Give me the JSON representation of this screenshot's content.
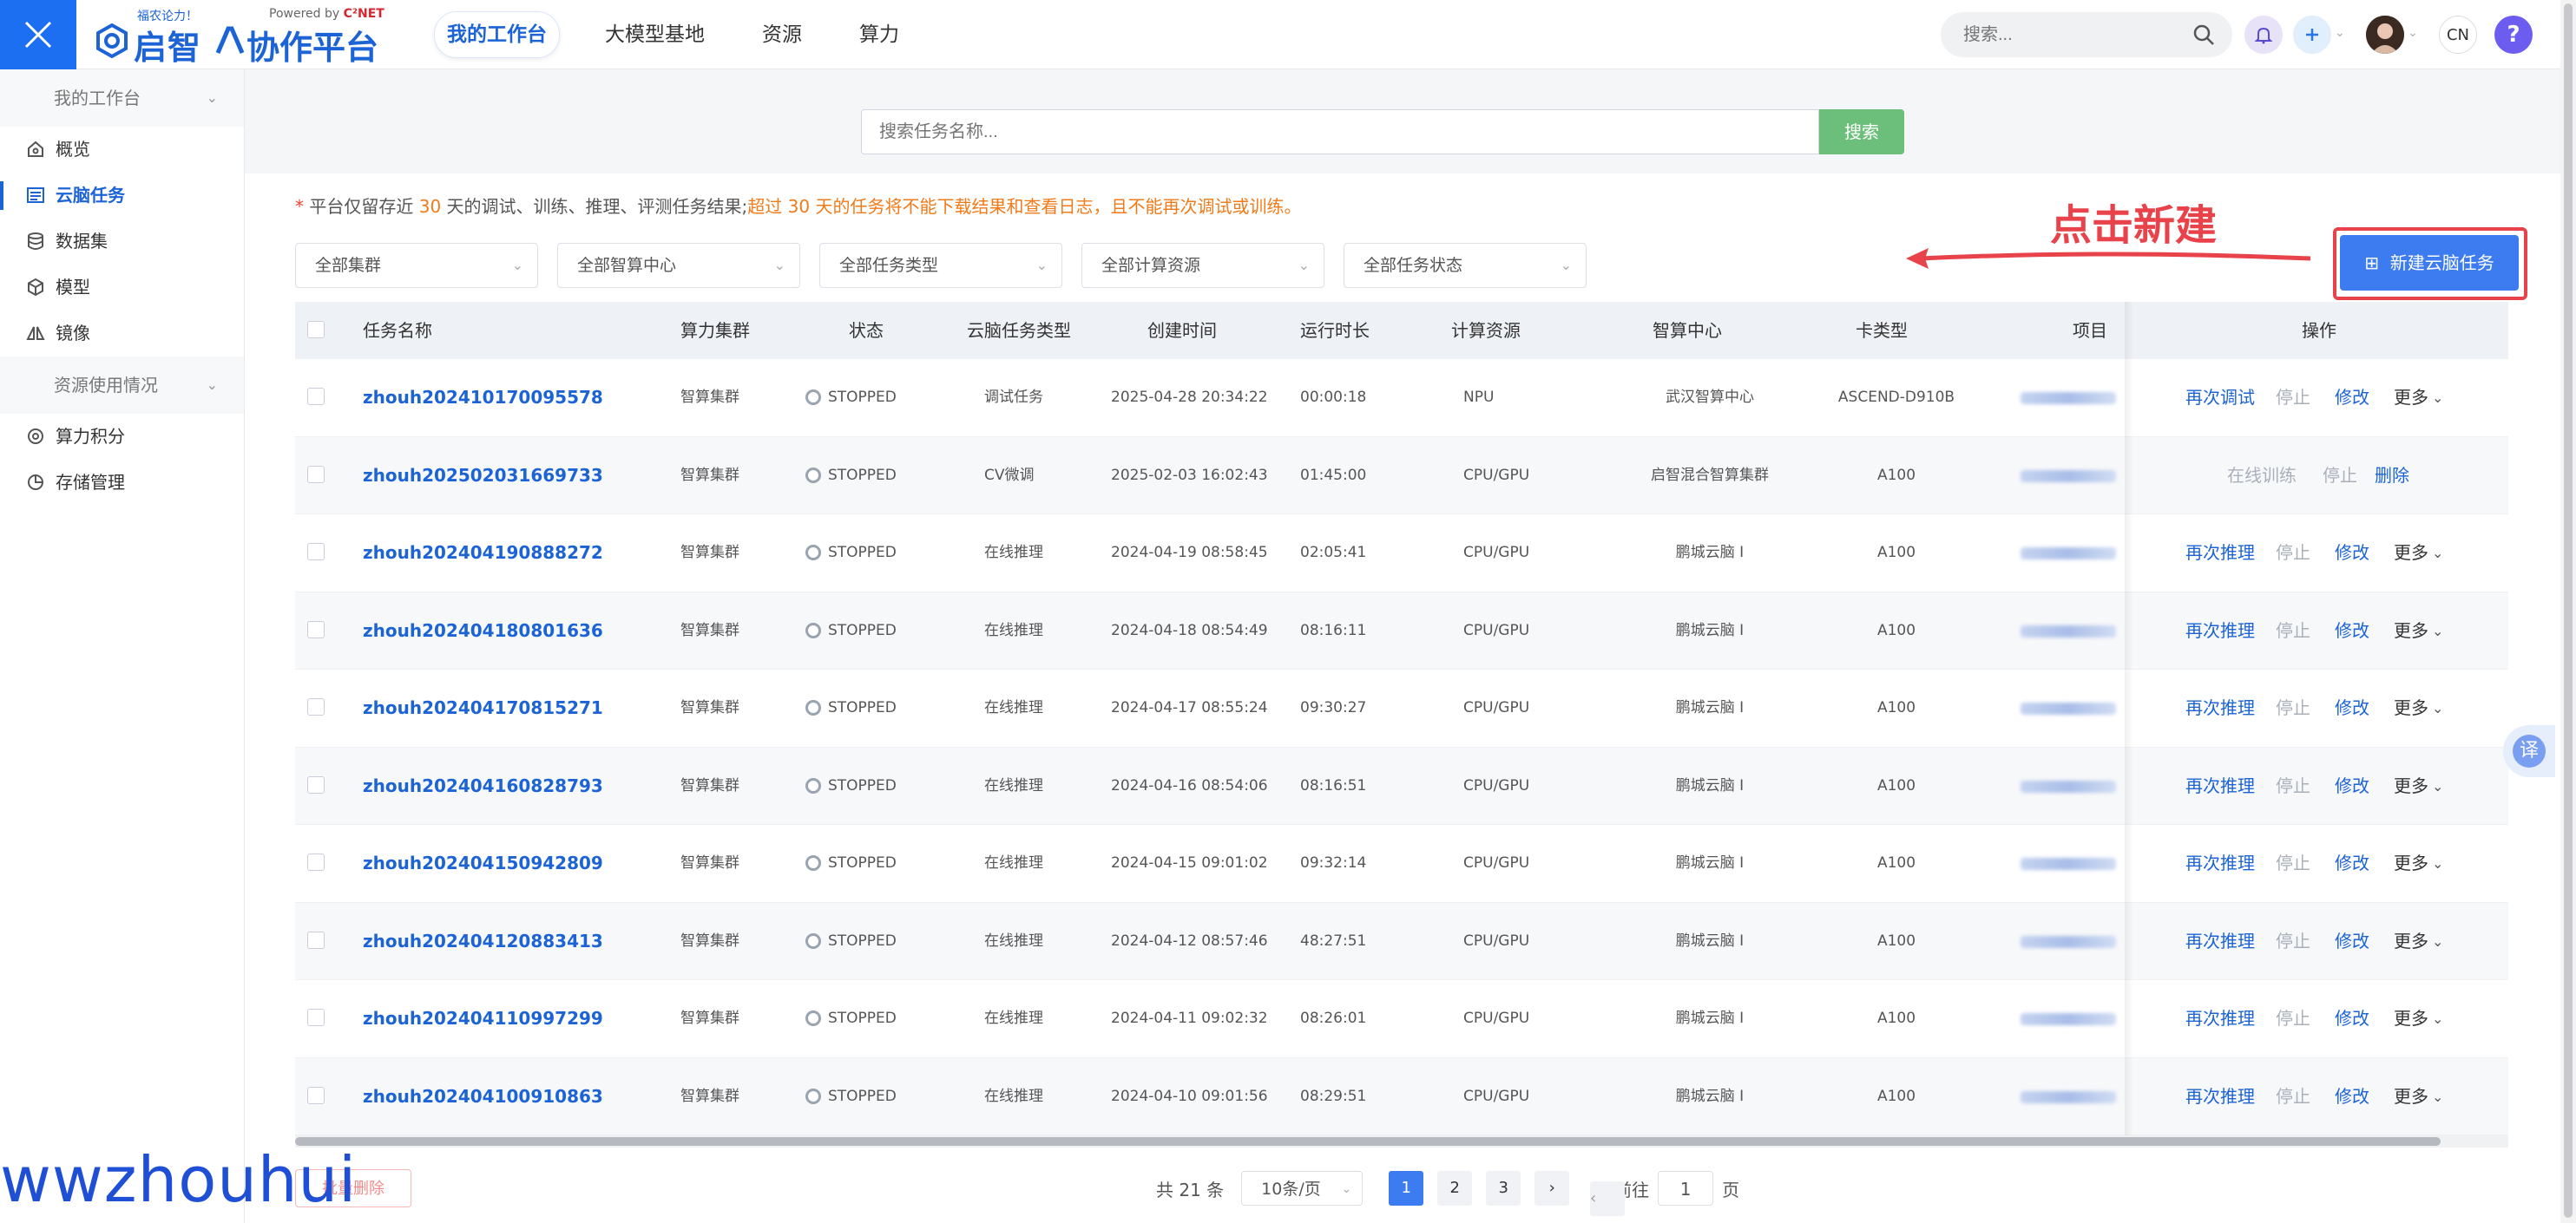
{
  "topbar": {
    "logo_slogan": "福农论力！",
    "powered_prefix": "Powered by ",
    "powered_brand": "C²NET",
    "logo_name1": "启智",
    "logo_name2": "协作平台",
    "tabs": [
      {
        "label": "我的工作台",
        "active": true
      },
      {
        "label": "大模型基地",
        "active": false
      },
      {
        "label": "资源",
        "active": false
      },
      {
        "label": "算力",
        "active": false
      }
    ],
    "search_placeholder": "搜索...",
    "lang": "CN",
    "help": "?"
  },
  "sidebar": {
    "group1": "我的工作台",
    "items": [
      {
        "label": "概览",
        "icon": "home-icon"
      },
      {
        "label": "云脑任务",
        "icon": "task-list-icon",
        "active": true
      },
      {
        "label": "数据集",
        "icon": "database-icon"
      },
      {
        "label": "模型",
        "icon": "model-cube-icon"
      },
      {
        "label": "镜像",
        "icon": "image-mirror-icon"
      }
    ],
    "group2": "资源使用情况",
    "items2": [
      {
        "label": "算力积分",
        "icon": "points-icon"
      },
      {
        "label": "存储管理",
        "icon": "storage-pie-icon"
      }
    ]
  },
  "search": {
    "placeholder": "搜索任务名称...",
    "button": "搜索"
  },
  "notice": {
    "prefix": "平台仅留存近",
    "days1": "30",
    "middle": "天的调试、训练、推理、评测任务结果;",
    "warn_prefix": "超过",
    "days2": "30",
    "warn_suffix": "天的任务将不能下载结果和查看日志，且不能再次调试或训练。"
  },
  "filters": [
    "全部集群",
    "全部智算中心",
    "全部任务类型",
    "全部计算资源",
    "全部任务状态"
  ],
  "annotation": "点击新建",
  "new_button": "新建云脑任务",
  "table": {
    "headers": [
      "任务名称",
      "算力集群",
      "状态",
      "云脑任务类型",
      "创建时间",
      "运行时长",
      "计算资源",
      "智算中心",
      "卡类型",
      "项目",
      "操作"
    ],
    "rows": [
      {
        "name": "zhouh202410170095578",
        "cluster": "智算集群",
        "status": "STOPPED",
        "type": "调试任务",
        "created": "2025-04-28 20:34:22",
        "duration": "00:00:18",
        "resource": "NPU",
        "center": "武汉智算中心",
        "card": "ASCEND-D910B",
        "ops": [
          "再次调试",
          "停止",
          "修改",
          "更多"
        ]
      },
      {
        "name": "zhouh202502031669733",
        "cluster": "智算集群",
        "status": "STOPPED",
        "type": "CV微调",
        "created": "2025-02-03 16:02:43",
        "duration": "01:45:00",
        "resource": "CPU/GPU",
        "center": "启智混合智算集群",
        "card": "A100",
        "ops": [
          "在线训练",
          "停止",
          "删除"
        ]
      },
      {
        "name": "zhouh202404190888272",
        "cluster": "智算集群",
        "status": "STOPPED",
        "type": "在线推理",
        "created": "2024-04-19 08:58:45",
        "duration": "02:05:41",
        "resource": "CPU/GPU",
        "center": "鹏城云脑 I",
        "card": "A100",
        "ops": [
          "再次推理",
          "停止",
          "修改",
          "更多"
        ]
      },
      {
        "name": "zhouh202404180801636",
        "cluster": "智算集群",
        "status": "STOPPED",
        "type": "在线推理",
        "created": "2024-04-18 08:54:49",
        "duration": "08:16:11",
        "resource": "CPU/GPU",
        "center": "鹏城云脑 I",
        "card": "A100",
        "ops": [
          "再次推理",
          "停止",
          "修改",
          "更多"
        ]
      },
      {
        "name": "zhouh202404170815271",
        "cluster": "智算集群",
        "status": "STOPPED",
        "type": "在线推理",
        "created": "2024-04-17 08:55:24",
        "duration": "09:30:27",
        "resource": "CPU/GPU",
        "center": "鹏城云脑 I",
        "card": "A100",
        "ops": [
          "再次推理",
          "停止",
          "修改",
          "更多"
        ]
      },
      {
        "name": "zhouh202404160828793",
        "cluster": "智算集群",
        "status": "STOPPED",
        "type": "在线推理",
        "created": "2024-04-16 08:54:06",
        "duration": "08:16:51",
        "resource": "CPU/GPU",
        "center": "鹏城云脑 I",
        "card": "A100",
        "ops": [
          "再次推理",
          "停止",
          "修改",
          "更多"
        ]
      },
      {
        "name": "zhouh202404150942809",
        "cluster": "智算集群",
        "status": "STOPPED",
        "type": "在线推理",
        "created": "2024-04-15 09:01:02",
        "duration": "09:32:14",
        "resource": "CPU/GPU",
        "center": "鹏城云脑 I",
        "card": "A100",
        "ops": [
          "再次推理",
          "停止",
          "修改",
          "更多"
        ]
      },
      {
        "name": "zhouh202404120883413",
        "cluster": "智算集群",
        "status": "STOPPED",
        "type": "在线推理",
        "created": "2024-04-12 08:57:46",
        "duration": "48:27:51",
        "resource": "CPU/GPU",
        "center": "鹏城云脑 I",
        "card": "A100",
        "ops": [
          "再次推理",
          "停止",
          "修改",
          "更多"
        ]
      },
      {
        "name": "zhouh202404110997299",
        "cluster": "智算集群",
        "status": "STOPPED",
        "type": "在线推理",
        "created": "2024-04-11 09:02:32",
        "duration": "08:26:01",
        "resource": "CPU/GPU",
        "center": "鹏城云脑 I",
        "card": "A100",
        "ops": [
          "再次推理",
          "停止",
          "修改",
          "更多"
        ]
      },
      {
        "name": "zhouh202404100910863",
        "cluster": "智算集群",
        "status": "STOPPED",
        "type": "在线推理",
        "created": "2024-04-10 09:01:56",
        "duration": "08:29:51",
        "resource": "CPU/GPU",
        "center": "鹏城云脑 I",
        "card": "A100",
        "ops": [
          "再次推理",
          "停止",
          "修改",
          "更多"
        ]
      }
    ]
  },
  "footer": {
    "batch_delete": "批量删除",
    "total": "共 21 条",
    "page_size": "10条/页",
    "pages": [
      "1",
      "2",
      "3"
    ],
    "current_page": "1",
    "goto_label": "前往",
    "goto_value": "1",
    "page_unit": "页"
  },
  "translate_label": "译",
  "watermark": "wwzhouhui"
}
